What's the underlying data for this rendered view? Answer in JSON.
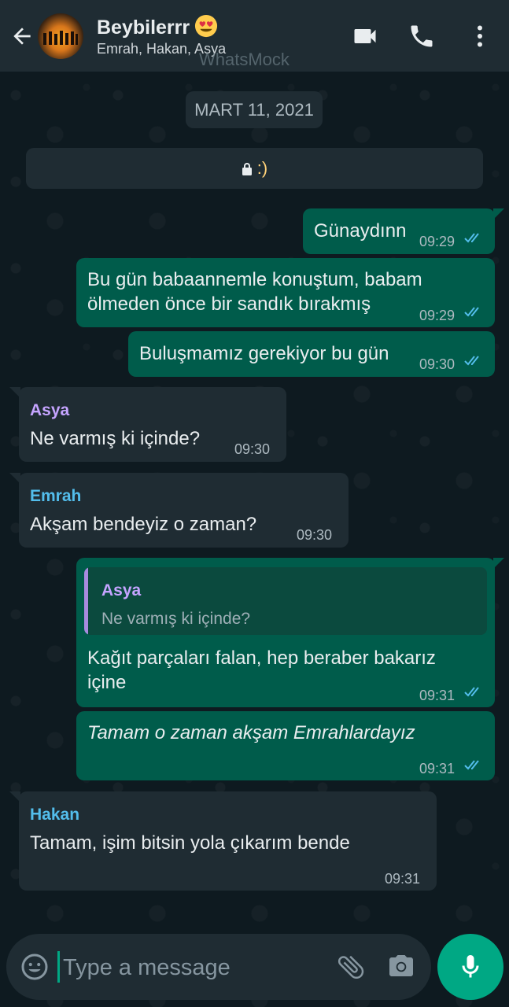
{
  "header": {
    "back_icon": "arrow-left-icon",
    "avatar_icon": "group-avatar",
    "title": "Beybilerrr",
    "title_emoji": "heart-eyes-emoji",
    "subtitle": "Emrah, Hakan, Asya",
    "watermark": "WhatsMock",
    "actions": [
      "video-call-icon",
      "phone-icon",
      "more-vert-icon"
    ]
  },
  "chat": {
    "date": "MART 11, 2021",
    "encryption_text": ":)",
    "messages": [
      {
        "dir": "out",
        "text": "Günaydınn",
        "time": "09:29",
        "status": "read"
      },
      {
        "dir": "out",
        "text_lines": [
          "Bu gün babaannemle konuştum, babam",
          "ölmeden önce bir sandık bırakmış"
        ],
        "time": "09:29",
        "status": "read"
      },
      {
        "dir": "out",
        "text": "Buluşmamız gerekiyor bu gün",
        "time": "09:30",
        "status": "read"
      },
      {
        "dir": "in",
        "sender": "Asya",
        "sender_color": "#c5a4ff",
        "text": "Ne varmış ki içinde?",
        "time": "09:30"
      },
      {
        "dir": "in",
        "sender": "Emrah",
        "sender_color": "#53bdeb",
        "text": "Akşam bendeyiz o zaman?",
        "time": "09:30"
      },
      {
        "dir": "out",
        "quote": {
          "sender": "Asya",
          "text": "Ne varmış ki içinde?"
        },
        "text_lines": [
          "Kağıt parçaları falan, hep beraber bakarız",
          "içine"
        ],
        "time": "09:31",
        "status": "read"
      },
      {
        "dir": "out",
        "text": "Tamam o zaman akşam Emrahlardayız",
        "italic": true,
        "time": "09:31",
        "status": "read"
      },
      {
        "dir": "in",
        "sender": "Hakan",
        "sender_color": "#53bdeb",
        "text": "Tamam, işim bitsin yola çıkarım bende",
        "time": "09:31"
      }
    ]
  },
  "composer": {
    "placeholder": "Type a message",
    "icons": [
      "emoji-icon",
      "attach-icon",
      "camera-icon"
    ],
    "send_icon": "mic-icon"
  },
  "colors": {
    "header_bg": "#1f2c33",
    "outgoing_bubble": "#005c4b",
    "incoming_bubble": "#1f2c33",
    "read_ticks": "#53bdeb",
    "accent": "#00a884"
  }
}
